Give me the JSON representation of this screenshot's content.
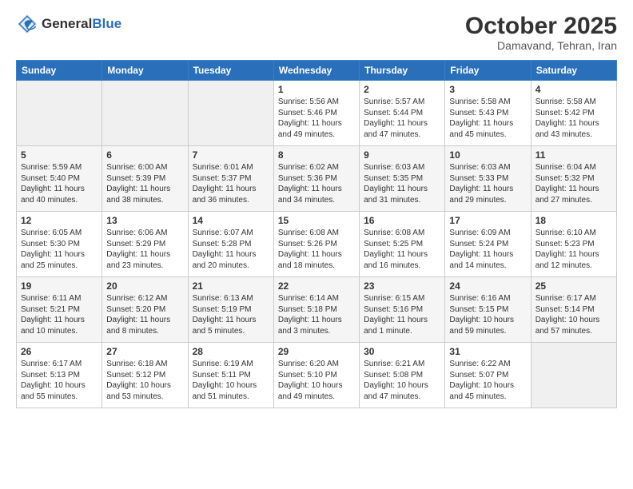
{
  "header": {
    "logo_line1": "General",
    "logo_line2": "Blue",
    "month": "October 2025",
    "location": "Damavand, Tehran, Iran"
  },
  "weekdays": [
    "Sunday",
    "Monday",
    "Tuesday",
    "Wednesday",
    "Thursday",
    "Friday",
    "Saturday"
  ],
  "weeks": [
    [
      {
        "day": "",
        "info": ""
      },
      {
        "day": "",
        "info": ""
      },
      {
        "day": "",
        "info": ""
      },
      {
        "day": "1",
        "info": "Sunrise: 5:56 AM\nSunset: 5:46 PM\nDaylight: 11 hours\nand 49 minutes."
      },
      {
        "day": "2",
        "info": "Sunrise: 5:57 AM\nSunset: 5:44 PM\nDaylight: 11 hours\nand 47 minutes."
      },
      {
        "day": "3",
        "info": "Sunrise: 5:58 AM\nSunset: 5:43 PM\nDaylight: 11 hours\nand 45 minutes."
      },
      {
        "day": "4",
        "info": "Sunrise: 5:58 AM\nSunset: 5:42 PM\nDaylight: 11 hours\nand 43 minutes."
      }
    ],
    [
      {
        "day": "5",
        "info": "Sunrise: 5:59 AM\nSunset: 5:40 PM\nDaylight: 11 hours\nand 40 minutes."
      },
      {
        "day": "6",
        "info": "Sunrise: 6:00 AM\nSunset: 5:39 PM\nDaylight: 11 hours\nand 38 minutes."
      },
      {
        "day": "7",
        "info": "Sunrise: 6:01 AM\nSunset: 5:37 PM\nDaylight: 11 hours\nand 36 minutes."
      },
      {
        "day": "8",
        "info": "Sunrise: 6:02 AM\nSunset: 5:36 PM\nDaylight: 11 hours\nand 34 minutes."
      },
      {
        "day": "9",
        "info": "Sunrise: 6:03 AM\nSunset: 5:35 PM\nDaylight: 11 hours\nand 31 minutes."
      },
      {
        "day": "10",
        "info": "Sunrise: 6:03 AM\nSunset: 5:33 PM\nDaylight: 11 hours\nand 29 minutes."
      },
      {
        "day": "11",
        "info": "Sunrise: 6:04 AM\nSunset: 5:32 PM\nDaylight: 11 hours\nand 27 minutes."
      }
    ],
    [
      {
        "day": "12",
        "info": "Sunrise: 6:05 AM\nSunset: 5:30 PM\nDaylight: 11 hours\nand 25 minutes."
      },
      {
        "day": "13",
        "info": "Sunrise: 6:06 AM\nSunset: 5:29 PM\nDaylight: 11 hours\nand 23 minutes."
      },
      {
        "day": "14",
        "info": "Sunrise: 6:07 AM\nSunset: 5:28 PM\nDaylight: 11 hours\nand 20 minutes."
      },
      {
        "day": "15",
        "info": "Sunrise: 6:08 AM\nSunset: 5:26 PM\nDaylight: 11 hours\nand 18 minutes."
      },
      {
        "day": "16",
        "info": "Sunrise: 6:08 AM\nSunset: 5:25 PM\nDaylight: 11 hours\nand 16 minutes."
      },
      {
        "day": "17",
        "info": "Sunrise: 6:09 AM\nSunset: 5:24 PM\nDaylight: 11 hours\nand 14 minutes."
      },
      {
        "day": "18",
        "info": "Sunrise: 6:10 AM\nSunset: 5:23 PM\nDaylight: 11 hours\nand 12 minutes."
      }
    ],
    [
      {
        "day": "19",
        "info": "Sunrise: 6:11 AM\nSunset: 5:21 PM\nDaylight: 11 hours\nand 10 minutes."
      },
      {
        "day": "20",
        "info": "Sunrise: 6:12 AM\nSunset: 5:20 PM\nDaylight: 11 hours\nand 8 minutes."
      },
      {
        "day": "21",
        "info": "Sunrise: 6:13 AM\nSunset: 5:19 PM\nDaylight: 11 hours\nand 5 minutes."
      },
      {
        "day": "22",
        "info": "Sunrise: 6:14 AM\nSunset: 5:18 PM\nDaylight: 11 hours\nand 3 minutes."
      },
      {
        "day": "23",
        "info": "Sunrise: 6:15 AM\nSunset: 5:16 PM\nDaylight: 11 hours\nand 1 minute."
      },
      {
        "day": "24",
        "info": "Sunrise: 6:16 AM\nSunset: 5:15 PM\nDaylight: 10 hours\nand 59 minutes."
      },
      {
        "day": "25",
        "info": "Sunrise: 6:17 AM\nSunset: 5:14 PM\nDaylight: 10 hours\nand 57 minutes."
      }
    ],
    [
      {
        "day": "26",
        "info": "Sunrise: 6:17 AM\nSunset: 5:13 PM\nDaylight: 10 hours\nand 55 minutes."
      },
      {
        "day": "27",
        "info": "Sunrise: 6:18 AM\nSunset: 5:12 PM\nDaylight: 10 hours\nand 53 minutes."
      },
      {
        "day": "28",
        "info": "Sunrise: 6:19 AM\nSunset: 5:11 PM\nDaylight: 10 hours\nand 51 minutes."
      },
      {
        "day": "29",
        "info": "Sunrise: 6:20 AM\nSunset: 5:10 PM\nDaylight: 10 hours\nand 49 minutes."
      },
      {
        "day": "30",
        "info": "Sunrise: 6:21 AM\nSunset: 5:08 PM\nDaylight: 10 hours\nand 47 minutes."
      },
      {
        "day": "31",
        "info": "Sunrise: 6:22 AM\nSunset: 5:07 PM\nDaylight: 10 hours\nand 45 minutes."
      },
      {
        "day": "",
        "info": ""
      }
    ]
  ]
}
